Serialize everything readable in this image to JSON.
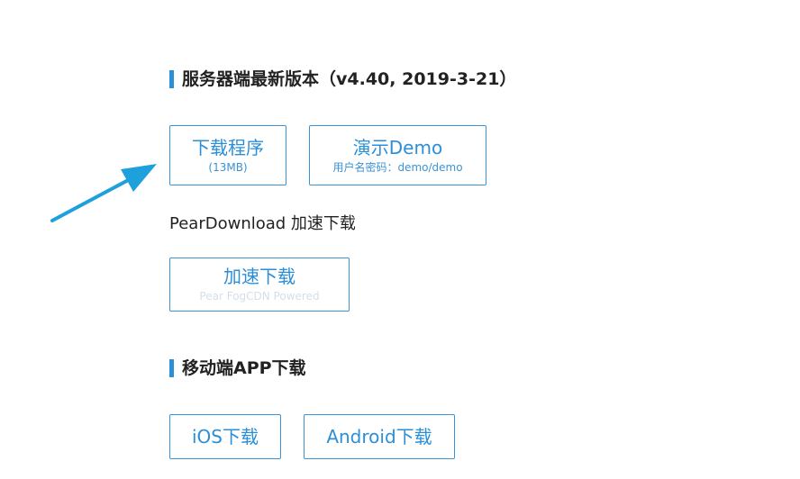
{
  "server_section": {
    "title": "服务器端最新版本（v4.40, 2019-3-21）",
    "download_button": {
      "label": "下载程序",
      "sub": "(13MB)"
    },
    "demo_button": {
      "label": "演示Demo",
      "sub": "用户名密码：demo/demo"
    }
  },
  "accelerated": {
    "label": "PearDownload 加速下载",
    "button": {
      "label": "加速下载",
      "sub": "Pear FogCDN Powered"
    }
  },
  "mobile_section": {
    "title": "移动端APP下载",
    "ios_button": "iOS下载",
    "android_button": "Android下载"
  },
  "colors": {
    "accent": "#2b8fd8",
    "arrow": "#1ea0dc"
  },
  "icons": {
    "pointer": "arrow-icon"
  }
}
